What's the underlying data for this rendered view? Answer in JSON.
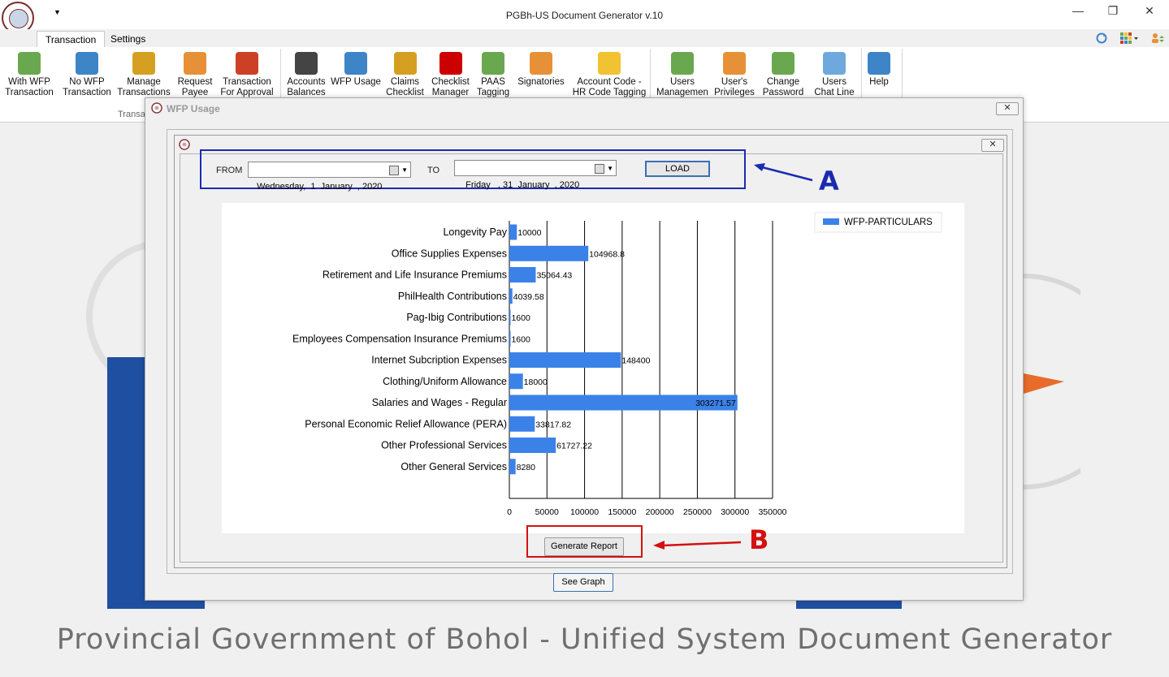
{
  "app": {
    "title": "PGBh-US Document Generator v.10",
    "footer_text": "Provincial Government of Bohol - Unified System Document Generator",
    "quick_access_glyph": "▼",
    "window_controls": {
      "minimize": "—",
      "restore": "❐",
      "close": "✕"
    }
  },
  "tabs": [
    {
      "label": "Transaction",
      "active": true
    },
    {
      "label": "Settings",
      "active": false
    }
  ],
  "tabbar_icons": [
    "refresh-icon",
    "grid-icon",
    "user-switch-icon"
  ],
  "ribbon": {
    "group_label": "Transa",
    "buttons": [
      {
        "line1": "With WFP",
        "line2": "Transaction",
        "icon": "doc-add-icon",
        "color": "#6aa84f"
      },
      {
        "line1": "No WFP",
        "line2": "Transaction",
        "icon": "doc-add-icon",
        "color": "#3d85c6"
      },
      {
        "line1": "Manage",
        "line2": "Transactions",
        "icon": "list-icon",
        "color": "#d5a021"
      },
      {
        "line1": "Request",
        "line2": "Payee",
        "icon": "user-arrow-icon",
        "color": "#e69138"
      },
      {
        "line1": "Transaction",
        "line2": "For Approval",
        "icon": "ab-icon",
        "color": "#cc4125"
      },
      {
        "line1": "Accounts",
        "line2": "Balances",
        "icon": "book-icon",
        "color": "#444444"
      },
      {
        "line1": "WFP Usage",
        "line2": "",
        "icon": "magnifier-doc-icon",
        "color": "#3d85c6"
      },
      {
        "line1": "Claims",
        "line2": "Checklist",
        "icon": "clipboard-icon",
        "color": "#d5a021"
      },
      {
        "line1": "Checklist",
        "line2": "Manager",
        "icon": "checklist-icon",
        "color": "#cc0000"
      },
      {
        "line1": "PAAS",
        "line2": "Tagging",
        "icon": "refresh-arrows-icon",
        "color": "#6aa84f"
      },
      {
        "line1": "Signatories",
        "line2": "",
        "icon": "people-icon",
        "color": "#e69138"
      },
      {
        "line1": "Account Code -",
        "line2": "HR Code Tagging",
        "icon": "tag-icon",
        "color": "#f1c232"
      },
      {
        "line1": "Users",
        "line2": "Management",
        "icon": "users-icon",
        "color": "#6aa84f"
      },
      {
        "line1": "User's",
        "line2": "Privileges",
        "icon": "user-gear-icon",
        "color": "#e69138"
      },
      {
        "line1": "Change",
        "line2": "Password",
        "icon": "user-refresh-icon",
        "color": "#6aa84f"
      },
      {
        "line1": "Users",
        "line2": "Chat Line",
        "icon": "chat-icon",
        "color": "#6fa8dc"
      },
      {
        "line1": "Help",
        "line2": "",
        "icon": "help-icon",
        "color": "#3d85c6"
      }
    ]
  },
  "wfp_window": {
    "title": "WFP Usage",
    "close_glyph": "✕",
    "filter": {
      "from_label": "FROM",
      "from_value": "Wednesday,  1  January  , 2020",
      "to_label": "TO",
      "to_value": " Friday   , 31  January  , 2020",
      "load_label": "LOAD"
    },
    "generate_label": "Generate Report",
    "see_graph_label": "See Graph"
  },
  "annotations": {
    "a": "A",
    "b": "B",
    "a_color": "#1a2bb0",
    "b_color": "#d41010"
  },
  "chart_data": {
    "type": "bar",
    "orientation": "horizontal",
    "categories": [
      "Longevity Pay",
      "Office Supplies Expenses",
      "Retirement and Life Insurance Premiums",
      "PhilHealth Contributions",
      "Pag-Ibig Contributions",
      "Employees Compensation Insurance Premiums",
      "Internet Subcription Expenses",
      "Clothing/Uniform Allowance",
      "Salaries and Wages - Regular",
      "Personal Economic Relief Allowance (PERA)",
      "Other Professional Services",
      "Other General Services"
    ],
    "series": [
      {
        "name": "WFP-PARTICULARS",
        "color": "#3b82e8",
        "values": [
          10000,
          104968.8,
          35064.43,
          4039.58,
          1600,
          1600,
          148400,
          18000,
          303271.57,
          33817.82,
          61727.22,
          8280
        ],
        "labels": [
          "10000",
          "104968.8",
          "35064.43",
          "4039.58",
          "1600",
          "1600",
          "148400",
          "18000",
          "303271.57",
          "33817.82",
          "61727.22",
          "8280"
        ]
      }
    ],
    "xlim": [
      0,
      350000
    ],
    "xticks": [
      0,
      50000,
      100000,
      150000,
      200000,
      250000,
      300000,
      350000
    ],
    "grid": true,
    "legend_position": "top-right"
  }
}
